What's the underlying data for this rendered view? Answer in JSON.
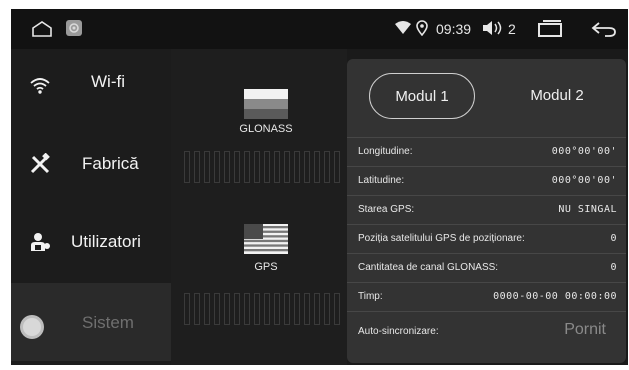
{
  "statusbar": {
    "time": "09:39",
    "volume": "2"
  },
  "sidebar": {
    "items": [
      {
        "label": "Wi-fi",
        "icon": "wifi-icon"
      },
      {
        "label": "Fabrică",
        "icon": "tools-icon"
      },
      {
        "label": "Utilizatori",
        "icon": "users-icon"
      },
      {
        "label": "Sistem",
        "icon": "system-toggle-icon"
      }
    ]
  },
  "satellites": {
    "glonass_label": "GLONASS",
    "gps_label": "GPS"
  },
  "panel": {
    "tabs": [
      {
        "label": "Modul 1",
        "selected": true
      },
      {
        "label": "Modul 2",
        "selected": false
      }
    ],
    "rows": [
      {
        "key": "Longitudine:",
        "value": "000°00'00'"
      },
      {
        "key": "Latitudine:",
        "value": "000°00'00'"
      },
      {
        "key": "Starea GPS:",
        "value": "NU SINGAL"
      },
      {
        "key": "Poziția satelitului GPS de poziționare:",
        "value": "0"
      },
      {
        "key": "Cantitatea de canal GLONASS:",
        "value": "0"
      },
      {
        "key": "Timp:",
        "value": "0000-00-00 00:00:00"
      },
      {
        "key": "Auto-sincronizare:",
        "value": "Pornit"
      }
    ]
  },
  "colors": {
    "background": "#1a1a1a",
    "panel": "#333333",
    "text": "#f0f0f0",
    "dim_text": "#6f6f6f"
  }
}
